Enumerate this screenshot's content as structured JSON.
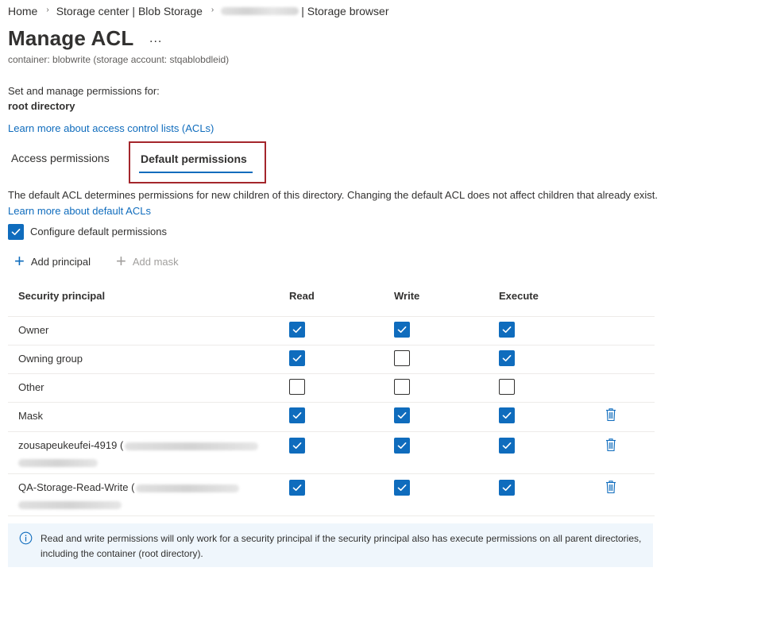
{
  "breadcrumb": {
    "home": "Home",
    "storage_center": "Storage center | Blob Storage",
    "storage_browser": "| Storage browser"
  },
  "page": {
    "title": "Manage ACL",
    "more": "...",
    "subtitle": "container: blobwrite (storage account: stqablobdleid)",
    "set_label": "Set and manage permissions for:",
    "target": "root directory",
    "learn_acl": "Learn more about access control lists (ACLs)"
  },
  "tabs": {
    "access": "Access permissions",
    "default": "Default permissions"
  },
  "description": {
    "text": "The default ACL determines permissions for new children of this directory. Changing the default ACL does not affect children that already exist.",
    "link": "Learn more about default ACLs"
  },
  "configure": {
    "label": "Configure default permissions",
    "checked": true
  },
  "commands": {
    "add_principal": "Add principal",
    "add_mask": "Add mask"
  },
  "table": {
    "headers": {
      "principal": "Security principal",
      "read": "Read",
      "write": "Write",
      "execute": "Execute"
    },
    "rows": [
      {
        "name": "Owner",
        "suffix": "",
        "read": true,
        "write": true,
        "execute": true,
        "deletable": false
      },
      {
        "name": "Owning group",
        "suffix": "",
        "read": true,
        "write": false,
        "execute": true,
        "deletable": false
      },
      {
        "name": "Other",
        "suffix": "",
        "read": false,
        "write": false,
        "execute": false,
        "deletable": false
      },
      {
        "name": "Mask",
        "suffix": "",
        "read": true,
        "write": true,
        "execute": true,
        "deletable": true
      },
      {
        "name": "zousapeukeufei-4919",
        "suffix": "(",
        "read": true,
        "write": true,
        "execute": true,
        "deletable": true
      },
      {
        "name": "QA-Storage-Read-Write",
        "suffix": "(",
        "read": true,
        "write": true,
        "execute": true,
        "deletable": true
      }
    ]
  },
  "info": {
    "text": "Read and write permissions will only work for a security principal if the security principal also has execute permissions on all parent directories, including the container (root directory)."
  },
  "colors": {
    "accent": "#0f6cbd",
    "tab_highlight": "#a4262c",
    "info_bg": "#eff6fc"
  },
  "icons": {
    "check": "check-icon",
    "trash": "trash-icon",
    "info": "info-icon",
    "plus": "plus-icon",
    "chevron": "chevron-right-icon"
  }
}
